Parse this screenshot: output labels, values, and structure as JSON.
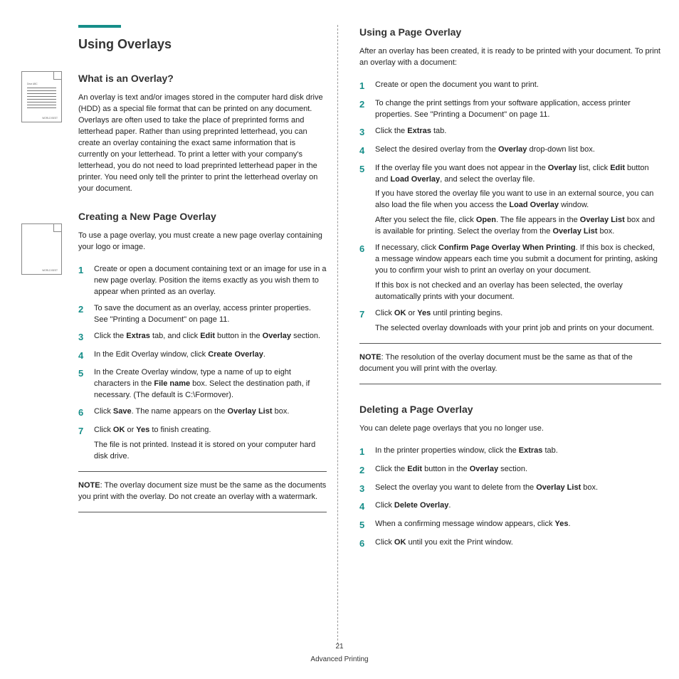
{
  "page": {
    "number": "21",
    "footer": "Advanced Printing"
  },
  "left": {
    "title": "Using Overlays",
    "section1": {
      "heading": "What is an Overlay?",
      "thumb_label_top": "Dear ABC",
      "thumb_label_bottom": "WORLD BEST",
      "body": "An overlay is text and/or images stored in the computer hard disk drive (HDD) as a special file format that can be printed on any document. Overlays are often used to take the place of preprinted forms and letterhead paper. Rather than using preprinted letterhead, you can create an overlay containing the exact same information that is currently on your letterhead. To print a letter with your company's letterhead, you do not need to load preprinted letterhead paper in the printer. You need only tell the printer to print the letterhead overlay on your document."
    },
    "section2": {
      "heading": "Creating a New Page Overlay",
      "thumb_label_bottom": "WORLD BEST",
      "intro": "To use a page overlay, you must create a new page overlay containing your logo or image.",
      "steps": [
        {
          "n": "1",
          "t": "Create or open a document containing text or an image for use in a new page overlay. Position the items exactly as you wish them to appear when printed as an overlay."
        },
        {
          "n": "2",
          "t": "To save the document as an overlay, access printer properties. See \"Printing a Document\" on page 11."
        },
        {
          "n": "3",
          "pre": "Click the ",
          "b1": "Extras",
          "mid": " tab, and click ",
          "b2": "Edit",
          "mid2": " button in the ",
          "b3": "Overlay",
          "post": " section."
        },
        {
          "n": "4",
          "pre": "In the Edit Overlay window, click ",
          "b1": "Create Overlay",
          "post": "."
        },
        {
          "n": "5",
          "pre": "In the Create Overlay window, type a name of up to eight characters in the ",
          "b1": "File name",
          "post": " box. Select the destination path, if necessary. (The default is C:\\Formover)."
        },
        {
          "n": "6",
          "pre": "Click ",
          "b1": "Save",
          "mid": ". The name appears on the ",
          "b2": "Overlay List",
          "post": " box."
        },
        {
          "n": "7",
          "pre": "Click ",
          "b1": "OK",
          "mid": " or ",
          "b2": "Yes",
          "post": " to finish creating.",
          "extra": "The file is not printed. Instead it is stored on your computer hard disk drive."
        }
      ],
      "note_label": "NOTE",
      "note": ": The overlay document size must be the same as the documents you print with the overlay. Do not create an overlay with a watermark."
    }
  },
  "right": {
    "section3": {
      "heading": "Using a Page Overlay",
      "intro": "After an overlay has been created, it is ready to be printed with your document. To print an overlay with a document:",
      "steps": [
        {
          "n": "1",
          "t": "Create or open the document you want to print."
        },
        {
          "n": "2",
          "t": "To change the print settings from your software application, access printer properties. See \"Printing a Document\" on page 11."
        },
        {
          "n": "3",
          "pre": "Click the ",
          "b1": "Extras",
          "post": " tab."
        },
        {
          "n": "4",
          "pre": "Select the desired overlay from the ",
          "b1": "Overlay",
          "post": " drop-down list box."
        },
        {
          "n": "5",
          "pre": "If the overlay file you want does not appear in the ",
          "b1": "Overlay",
          "mid": " list, click ",
          "b2": "Edit",
          "mid2": " button and ",
          "b3": "Load Overlay",
          "post": ", and select the overlay file.",
          "p2_pre": "If you have stored the overlay file you want to use in an external source, you can also load the file when you access the ",
          "p2_b": "Load Overlay",
          "p2_post": " window.",
          "p3_pre": "After you select the file, click ",
          "p3_b": "Open",
          "p3_mid": ". The file appears in the ",
          "p3_b2": "Overlay List",
          "p3_mid2": " box and is available for printing. Select the overlay from the ",
          "p3_b3": "Overlay List",
          "p3_post": " box."
        },
        {
          "n": "6",
          "pre": "If necessary, click ",
          "b1": "Confirm Page Overlay When Printing",
          "post": ". If this box is checked, a message window appears each time you submit a document for printing, asking you to confirm your wish to print an overlay on your document.",
          "p2": "If this box is not checked and an overlay has been selected, the overlay automatically prints with your document."
        },
        {
          "n": "7",
          "pre": "Click ",
          "b1": "OK",
          "mid": " or ",
          "b2": "Yes",
          "post": " until printing begins.",
          "p2": "The selected overlay downloads with your print job and prints on your document."
        }
      ],
      "note_label": "NOTE",
      "note": ": The resolution of the overlay document must be the same as that of the document you will print with the overlay."
    },
    "section4": {
      "heading": "Deleting a Page Overlay",
      "intro": "You can delete page overlays that you no longer use.",
      "steps": [
        {
          "n": "1",
          "pre": "In the printer properties window, click the ",
          "b1": "Extras",
          "post": " tab."
        },
        {
          "n": "2",
          "pre": "Click the ",
          "b1": "Edit",
          "mid": " button in the ",
          "b2": "Overlay",
          "post": " section."
        },
        {
          "n": "3",
          "pre": "Select the overlay you want to delete from the ",
          "b1": "Overlay List",
          "post": " box."
        },
        {
          "n": "4",
          "pre": "Click ",
          "b1": "Delete Overlay",
          "post": "."
        },
        {
          "n": "5",
          "pre": "When a confirming message window appears, click ",
          "b1": "Yes",
          "post": "."
        },
        {
          "n": "6",
          "pre": "Click ",
          "b1": "OK",
          "post": " until you exit the Print window."
        }
      ]
    }
  }
}
